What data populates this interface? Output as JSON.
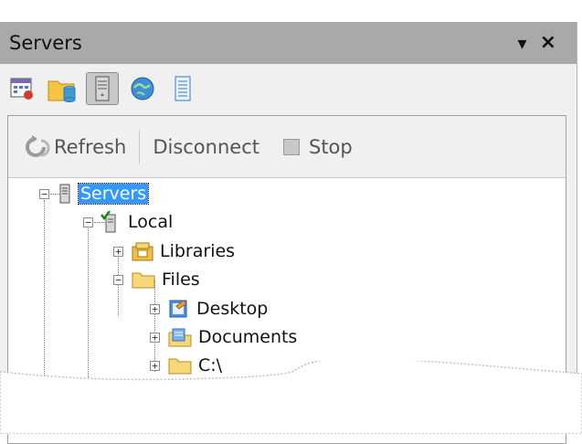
{
  "panel": {
    "title": "Servers"
  },
  "actions": {
    "refresh": "Refresh",
    "disconnect": "Disconnect",
    "stop": "Stop"
  },
  "tree": [
    {
      "label": "Servers",
      "selected": true
    },
    {
      "label": "Local"
    },
    {
      "label": "Libraries"
    },
    {
      "label": "Files"
    },
    {
      "label": "Desktop"
    },
    {
      "label": "Documents"
    },
    {
      "label": "C:\\"
    }
  ]
}
